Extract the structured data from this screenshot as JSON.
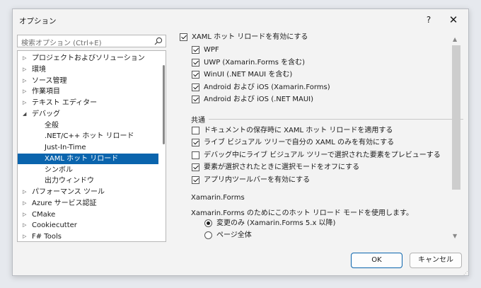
{
  "dialog": {
    "title": "オプション",
    "help": "?",
    "close": "✕"
  },
  "search": {
    "placeholder": "検索オプション (Ctrl+E)"
  },
  "tree": [
    {
      "label": "プロジェクトおよびソリューション",
      "expander": "▷",
      "level": 0
    },
    {
      "label": "環境",
      "expander": "▷",
      "level": 0
    },
    {
      "label": "ソース管理",
      "expander": "▷",
      "level": 0
    },
    {
      "label": "作業項目",
      "expander": "▷",
      "level": 0
    },
    {
      "label": "テキスト エディター",
      "expander": "▷",
      "level": 0
    },
    {
      "label": "デバッグ",
      "expander": "◢",
      "level": 0
    },
    {
      "label": "全般",
      "expander": "",
      "level": 1
    },
    {
      "label": ".NET/C++ ホット リロード",
      "expander": "",
      "level": 1
    },
    {
      "label": "Just-In-Time",
      "expander": "",
      "level": 1
    },
    {
      "label": "XAML ホット リロード",
      "expander": "",
      "level": 1,
      "selected": true
    },
    {
      "label": "シンボル",
      "expander": "",
      "level": 1
    },
    {
      "label": "出力ウィンドウ",
      "expander": "",
      "level": 1
    },
    {
      "label": "パフォーマンス ツール",
      "expander": "▷",
      "level": 0
    },
    {
      "label": "Azure サービス認証",
      "expander": "▷",
      "level": 0
    },
    {
      "label": "CMake",
      "expander": "▷",
      "level": 0
    },
    {
      "label": "Cookiecutter",
      "expander": "▷",
      "level": 0
    },
    {
      "label": "F# Tools",
      "expander": "▷",
      "level": 0
    }
  ],
  "content": {
    "main_checkbox": {
      "label": "XAML ホット リロードを有効にする",
      "checked": true
    },
    "platforms": [
      {
        "label": "WPF",
        "checked": true
      },
      {
        "label": "UWP (Xamarin.Forms を含む)",
        "checked": true
      },
      {
        "label": "WinUI (.NET MAUI を含む)",
        "checked": true
      },
      {
        "label": "Android および iOS (Xamarin.Forms)",
        "checked": true
      },
      {
        "label": "Android および iOS (.NET MAUI)",
        "checked": true
      }
    ],
    "common_section": "共通",
    "common": [
      {
        "label": "ドキュメントの保存時に XAML ホット リロードを適用する",
        "checked": false
      },
      {
        "label": "ライブ ビジュアル ツリーで自分の XAML のみを有効にする",
        "checked": true
      },
      {
        "label": "デバッグ中にライブ ビジュアル ツリーで選択された要素をプレビューする",
        "checked": false
      },
      {
        "label": "要素が選択されたときに選択モードをオフにする",
        "checked": true
      },
      {
        "label": "アプリ内ツールバーを有効にする",
        "checked": true
      }
    ],
    "xamarin_section": "Xamarin.Forms",
    "xamarin_desc": "Xamarin.Forms のためにこのホット リロード モードを使用します。",
    "xamarin_options": [
      {
        "label": "変更のみ (Xamarin.Forms 5.x 以降)",
        "checked": true
      },
      {
        "label": "ページ全体",
        "checked": false
      }
    ]
  },
  "buttons": {
    "ok": "OK",
    "cancel": "キャンセル"
  }
}
